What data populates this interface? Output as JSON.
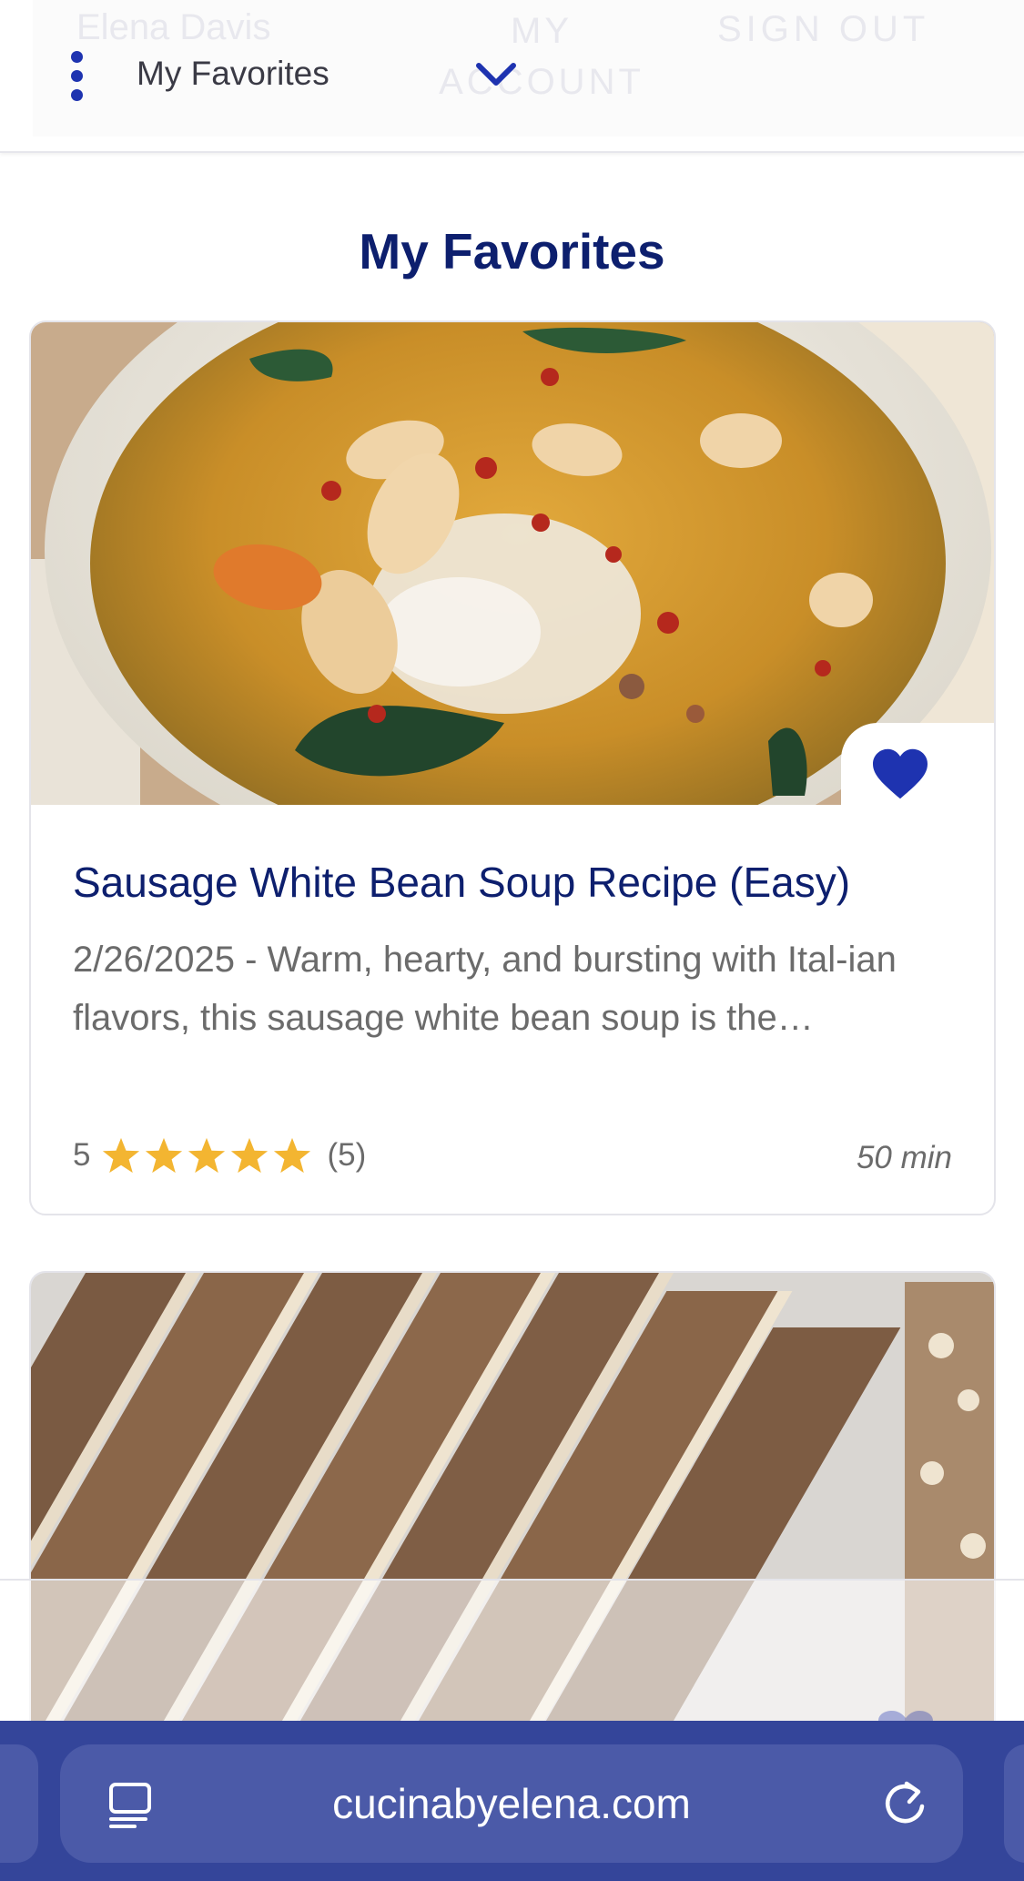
{
  "header": {
    "ghost_user_name": "Elena Davis",
    "ghost_my_account": "MY ACCOUNT",
    "ghost_sign_out": "SIGN OUT",
    "menu_label": "My Favorites"
  },
  "page": {
    "title": "My Favorites"
  },
  "cards": [
    {
      "title": "Sausage White Bean Soup Recipe (Easy)",
      "description": "2/26/2025 - Warm, hearty, and bursting with Ital-ian flavors, this sausage white bean soup is the…",
      "rating_value": "5",
      "rating_stars": 5,
      "rating_count": "(5)",
      "time": "50 min",
      "favorited": true,
      "image": "soup-photo"
    },
    {
      "image": "seeded-bread-photo",
      "favorited": true
    }
  ],
  "browser": {
    "url": "cucinabyelena.com",
    "reader_icon": "reader-mode-icon",
    "reload_icon": "reload-icon"
  },
  "colors": {
    "brand_navy": "#0d1f6e",
    "accent_blue": "#1e33b0",
    "star_gold": "#f3b531",
    "browser_bar": "#34459a",
    "url_pill": "#4b5aa8"
  }
}
